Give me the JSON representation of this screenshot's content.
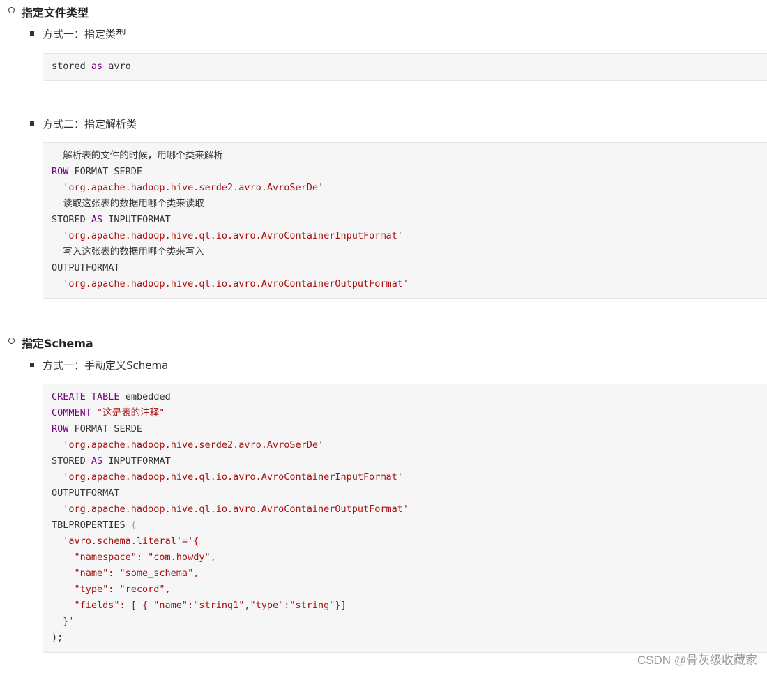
{
  "sections": [
    {
      "heading": "指定文件类型",
      "items": [
        {
          "label": "方式一：指定类型",
          "code": [
            [
              {
                "t": "stored ",
                "c": ""
              },
              {
                "t": "as",
                "c": "kw"
              },
              {
                "t": " avro",
                "c": ""
              }
            ]
          ]
        },
        {
          "label": "方式二：指定解析类",
          "code": [
            [
              {
                "t": "--",
                "c": "cm"
              },
              {
                "t": "解析表的文件的时候，用哪个类来解析",
                "c": ""
              }
            ],
            [
              {
                "t": "ROW",
                "c": "kw"
              },
              {
                "t": " FORMAT SERDE",
                "c": ""
              }
            ],
            [
              {
                "t": "  ",
                "c": ""
              },
              {
                "t": "'org.apache.hadoop.hive.serde2.avro.AvroSerDe'",
                "c": "str"
              }
            ],
            [
              {
                "t": "--",
                "c": "cm"
              },
              {
                "t": "读取这张表的数据用哪个类来读取",
                "c": ""
              }
            ],
            [
              {
                "t": "STORED ",
                "c": ""
              },
              {
                "t": "AS",
                "c": "kw"
              },
              {
                "t": " INPUTFORMAT",
                "c": ""
              }
            ],
            [
              {
                "t": "  ",
                "c": ""
              },
              {
                "t": "'org.apache.hadoop.hive.ql.io.avro.AvroContainerInputFormat'",
                "c": "str"
              }
            ],
            [
              {
                "t": "--",
                "c": "cm"
              },
              {
                "t": "写入这张表的数据用哪个类来写入",
                "c": ""
              }
            ],
            [
              {
                "t": "OUTPUTFORMAT",
                "c": ""
              }
            ],
            [
              {
                "t": "  ",
                "c": ""
              },
              {
                "t": "'org.apache.hadoop.hive.ql.io.avro.AvroContainerOutputFormat'",
                "c": "str"
              }
            ]
          ]
        }
      ]
    },
    {
      "heading": "指定Schema",
      "items": [
        {
          "label": "方式一：手动定义Schema",
          "code": [
            [
              {
                "t": "CREATE",
                "c": "kw"
              },
              {
                "t": " ",
                "c": ""
              },
              {
                "t": "TABLE",
                "c": "kw"
              },
              {
                "t": " embedded",
                "c": ""
              }
            ],
            [
              {
                "t": "COMMENT",
                "c": "kw"
              },
              {
                "t": " ",
                "c": ""
              },
              {
                "t": "\"这是表的注释\"",
                "c": "str"
              }
            ],
            [
              {
                "t": "ROW",
                "c": "kw"
              },
              {
                "t": " FORMAT SERDE",
                "c": ""
              }
            ],
            [
              {
                "t": "  ",
                "c": ""
              },
              {
                "t": "'org.apache.hadoop.hive.serde2.avro.AvroSerDe'",
                "c": "str"
              }
            ],
            [
              {
                "t": "STORED ",
                "c": ""
              },
              {
                "t": "AS",
                "c": "kw"
              },
              {
                "t": " INPUTFORMAT",
                "c": ""
              }
            ],
            [
              {
                "t": "  ",
                "c": ""
              },
              {
                "t": "'org.apache.hadoop.hive.ql.io.avro.AvroContainerInputFormat'",
                "c": "str"
              }
            ],
            [
              {
                "t": "OUTPUTFORMAT",
                "c": ""
              }
            ],
            [
              {
                "t": "  ",
                "c": ""
              },
              {
                "t": "'org.apache.hadoop.hive.ql.io.avro.AvroContainerOutputFormat'",
                "c": "str"
              }
            ],
            [
              {
                "t": "TBLPROPERTIES ",
                "c": ""
              },
              {
                "t": "(",
                "c": "pun"
              }
            ],
            [
              {
                "t": "  ",
                "c": ""
              },
              {
                "t": "'avro.schema.literal'='{",
                "c": "str"
              }
            ],
            [
              {
                "t": "    \"namespace\": \"com.howdy\",",
                "c": "str"
              }
            ],
            [
              {
                "t": "    \"name\": \"some_schema\",",
                "c": "str"
              }
            ],
            [
              {
                "t": "    \"type\": \"record\",",
                "c": "str"
              }
            ],
            [
              {
                "t": "    \"fields\": [ { \"name\":\"string1\",\"type\":\"string\"}]",
                "c": "str"
              }
            ],
            [
              {
                "t": "  }'",
                "c": "str"
              }
            ],
            [
              {
                "t": ");",
                "c": ""
              }
            ]
          ]
        }
      ]
    }
  ],
  "watermark": "CSDN @骨灰级收藏家",
  "colors": {
    "keyword": "#770088",
    "string": "#aa1111",
    "comment_marker": "#aa5500",
    "code_background": "#f6f6f6"
  }
}
